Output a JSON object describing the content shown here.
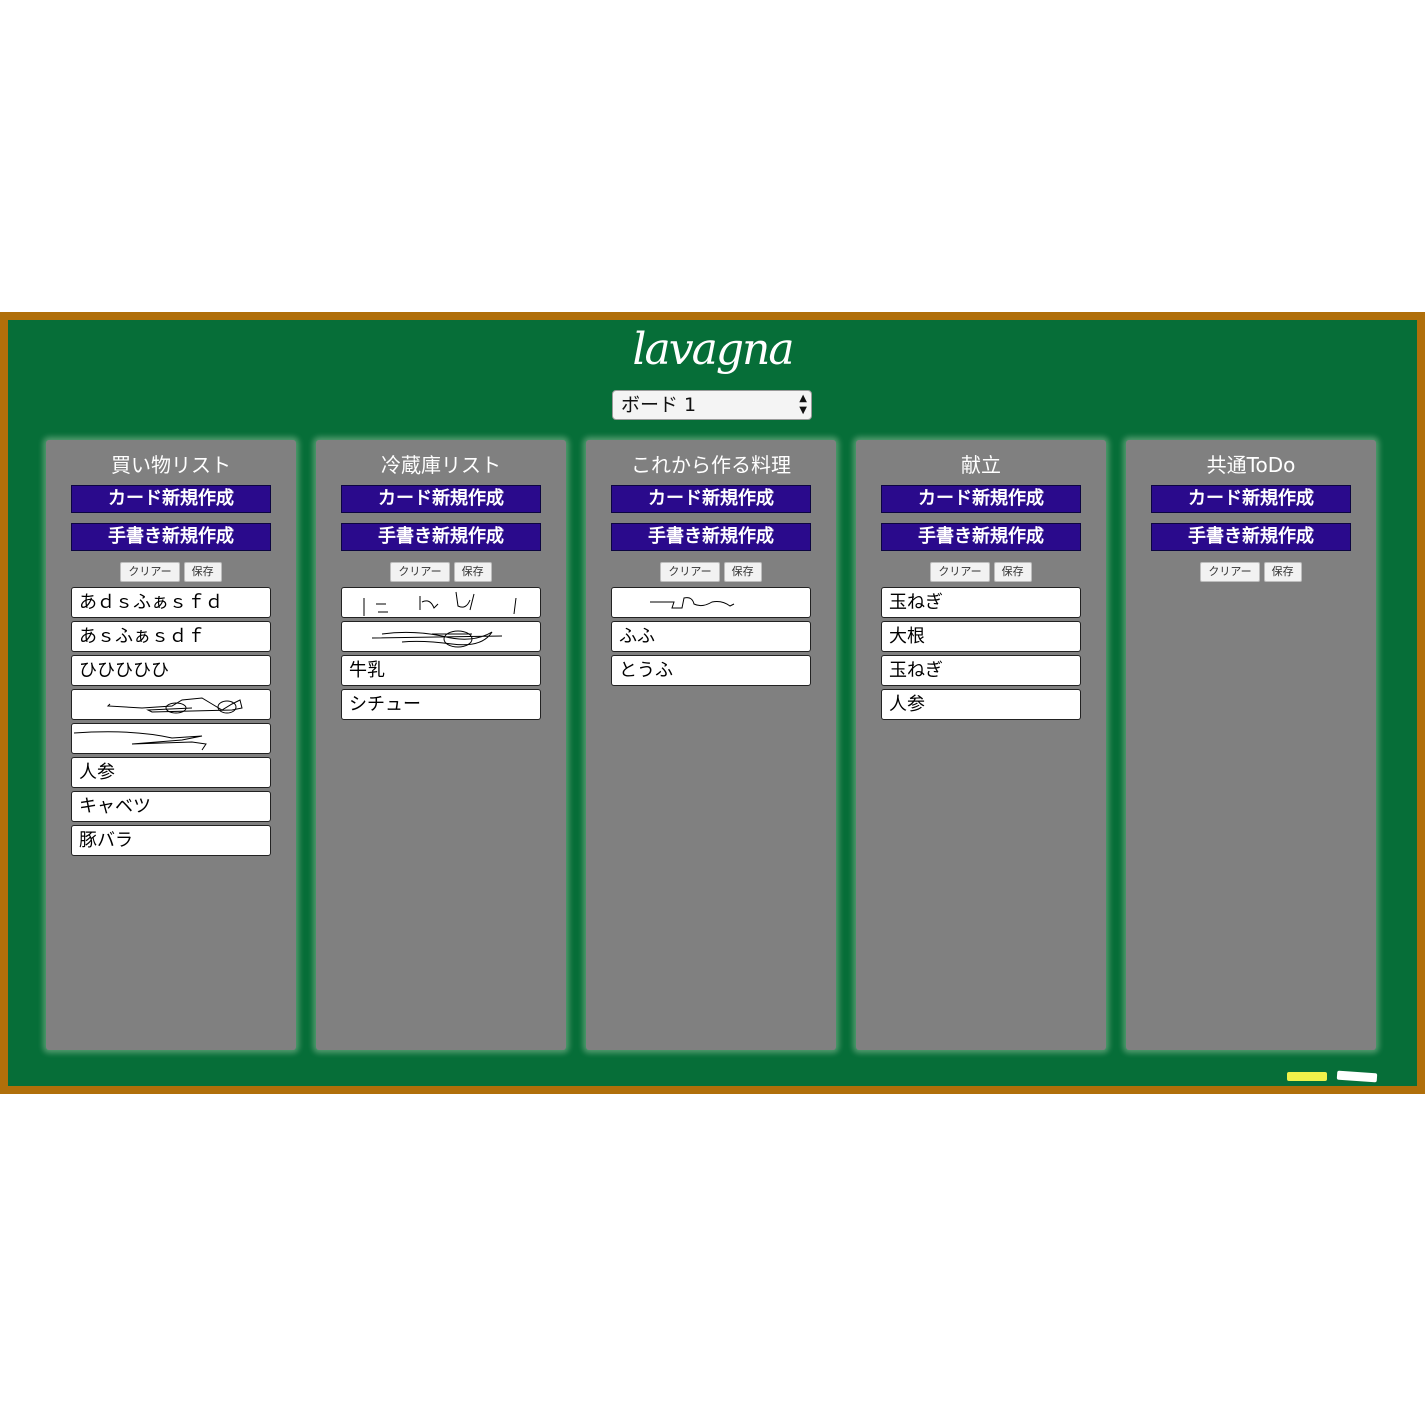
{
  "app": {
    "title": "lavagna"
  },
  "board_selector": {
    "selected": "ボード 1"
  },
  "columns": [
    {
      "title": "買い物リスト",
      "create_card_label": "カード新規作成",
      "create_handwriting_label": "手書き新規作成",
      "clear_label": "クリアー",
      "save_label": "保存",
      "cards": [
        {
          "type": "text",
          "text": "あｄｓふぁｓｆｄ"
        },
        {
          "type": "text",
          "text": "あｓふぁｓｄｆ"
        },
        {
          "type": "text",
          "text": "ひひひひひ"
        },
        {
          "type": "drawing",
          "text": ""
        },
        {
          "type": "drawing",
          "text": ""
        },
        {
          "type": "text",
          "text": "人参"
        },
        {
          "type": "text",
          "text": "キャベツ"
        },
        {
          "type": "text",
          "text": "豚バラ"
        }
      ]
    },
    {
      "title": "冷蔵庫リスト",
      "create_card_label": "カード新規作成",
      "create_handwriting_label": "手書き新規作成",
      "clear_label": "クリアー",
      "save_label": "保存",
      "cards": [
        {
          "type": "drawing",
          "text": ""
        },
        {
          "type": "drawing",
          "text": ""
        },
        {
          "type": "text",
          "text": "牛乳"
        },
        {
          "type": "text",
          "text": "シチュー"
        }
      ]
    },
    {
      "title": "これから作る料理",
      "create_card_label": "カード新規作成",
      "create_handwriting_label": "手書き新規作成",
      "clear_label": "クリアー",
      "save_label": "保存",
      "cards": [
        {
          "type": "drawing",
          "text": ""
        },
        {
          "type": "text",
          "text": "ふふ"
        },
        {
          "type": "text",
          "text": "とうふ"
        }
      ]
    },
    {
      "title": "献立",
      "create_card_label": "カード新規作成",
      "create_handwriting_label": "手書き新規作成",
      "clear_label": "クリアー",
      "save_label": "保存",
      "cards": [
        {
          "type": "text",
          "text": "玉ねぎ"
        },
        {
          "type": "text",
          "text": "大根"
        },
        {
          "type": "text",
          "text": "玉ねぎ"
        },
        {
          "type": "text",
          "text": "人参"
        }
      ]
    },
    {
      "title": "共通ToDo",
      "create_card_label": "カード新規作成",
      "create_handwriting_label": "手書き新規作成",
      "clear_label": "クリアー",
      "save_label": "保存",
      "cards": []
    }
  ],
  "colors": {
    "frame": "#b06f0a",
    "board": "#066e38",
    "column": "#808080",
    "button": "#2a0a8c",
    "chalk_yellow": "#f0f24a",
    "chalk_white": "#ffffff"
  }
}
